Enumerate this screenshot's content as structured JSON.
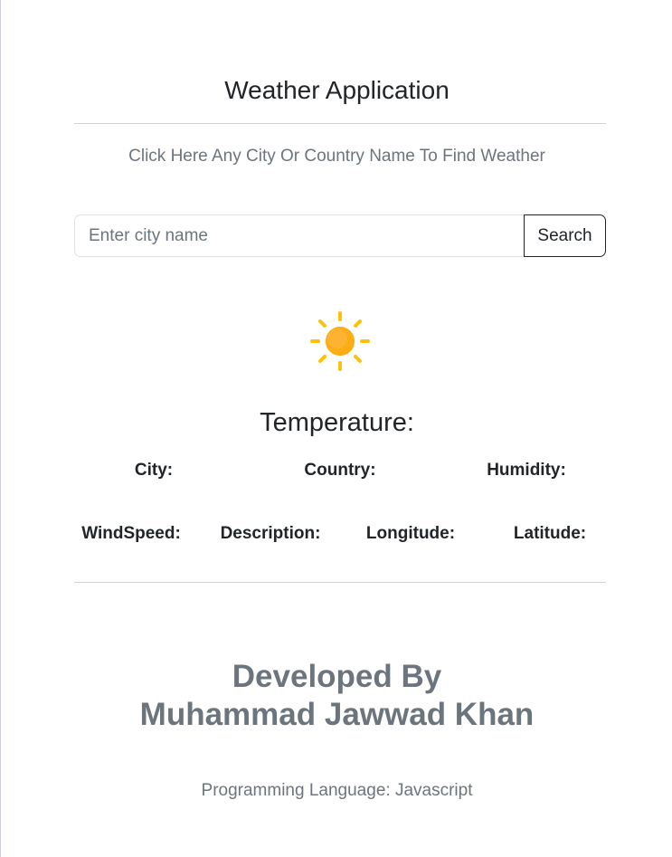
{
  "header": {
    "title": "Weather Application",
    "subtitle": "Click Here Any City Or Country Name To Find Weather"
  },
  "search": {
    "placeholder": "Enter city name",
    "value": "",
    "button_label": "Search"
  },
  "weather": {
    "icon": "sun-icon",
    "icon_colors": {
      "disc": "#F9A825",
      "rays": "#FFC107"
    },
    "temperature_label": "Temperature:",
    "city_label": "City:",
    "country_label": "Country:",
    "humidity_label": "Humidity:",
    "windspeed_label": "WindSpeed:",
    "description_label": "Description:",
    "longitude_label": "Longitude:",
    "latitude_label": "Latitude:"
  },
  "footer": {
    "developed_by": "Developed By",
    "developer_name": "Muhammad Jawwad Khan",
    "language": "Programming Language: Javascript"
  }
}
